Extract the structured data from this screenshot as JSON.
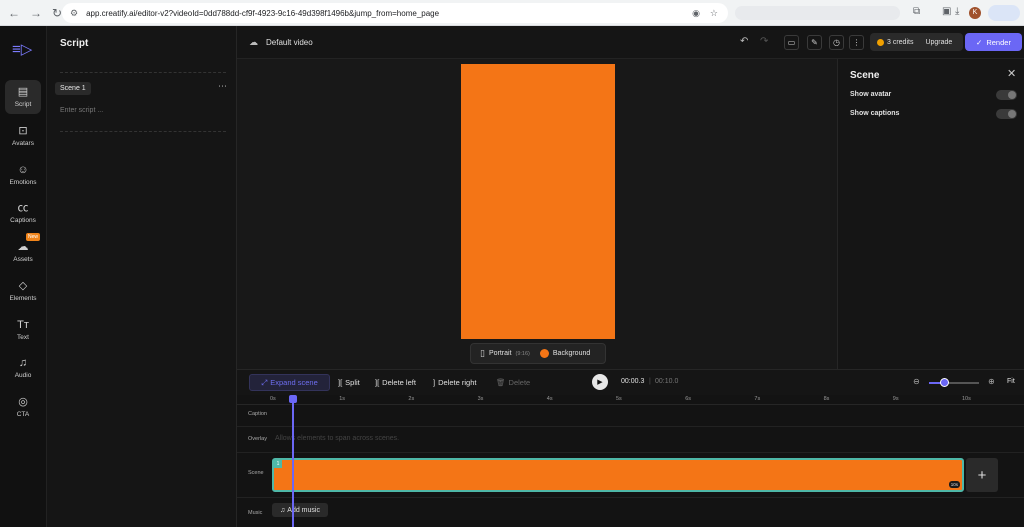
{
  "browser": {
    "url": "app.creatify.ai/editor-v2?videoId=0dd788dd-cf9f-4923-9c16-49d398f1496b&jump_from=home_page",
    "profile_initial": "K"
  },
  "rail": {
    "items": [
      {
        "label": "Script",
        "icon": "script-icon"
      },
      {
        "label": "Avatars",
        "icon": "avatar-icon"
      },
      {
        "label": "Emotions",
        "icon": "emotion-icon"
      },
      {
        "label": "Captions",
        "icon": "captions-icon"
      },
      {
        "label": "Assets",
        "icon": "cloud-upload-icon"
      },
      {
        "label": "Elements",
        "icon": "shapes-icon"
      },
      {
        "label": "Text",
        "icon": "text-icon"
      },
      {
        "label": "Audio",
        "icon": "music-icon"
      },
      {
        "label": "CTA",
        "icon": "cta-icon"
      }
    ],
    "new_badge": "New"
  },
  "script_panel": {
    "title": "Script",
    "scene_label": "Scene 1",
    "placeholder": "Enter script ..."
  },
  "topbar": {
    "video_name": "Default video",
    "credits": "3 credits",
    "upgrade": "Upgrade",
    "render": "Render"
  },
  "canvas": {
    "ratio_label": "Portrait",
    "ratio_value": "(9:16)",
    "background_label": "Background",
    "background_color": "#f47516"
  },
  "scene_panel": {
    "title": "Scene",
    "show_avatar": "Show avatar",
    "show_captions": "Show captions"
  },
  "timeline_toolbar": {
    "expand": "Expand scene",
    "split": "Split",
    "delete_left": "Delete left",
    "delete_right": "Delete right",
    "delete": "Delete",
    "current_time": "00:00.3",
    "total_time": "00:10.0",
    "fit": "Fit",
    "zoom_level": 0.3
  },
  "timeline": {
    "ticks": [
      "0s",
      "1s",
      "2s",
      "3s",
      "4s",
      "5s",
      "6s",
      "7s",
      "8s",
      "9s",
      "10s"
    ],
    "tracks": {
      "caption": "Caption",
      "overlay": "Overlay",
      "scene": "Scene",
      "music": "Music"
    },
    "overlay_hint": "Allows elements to span across scenes.",
    "scene_number": "1",
    "scene_duration": "10s",
    "add_music": "Add music"
  }
}
